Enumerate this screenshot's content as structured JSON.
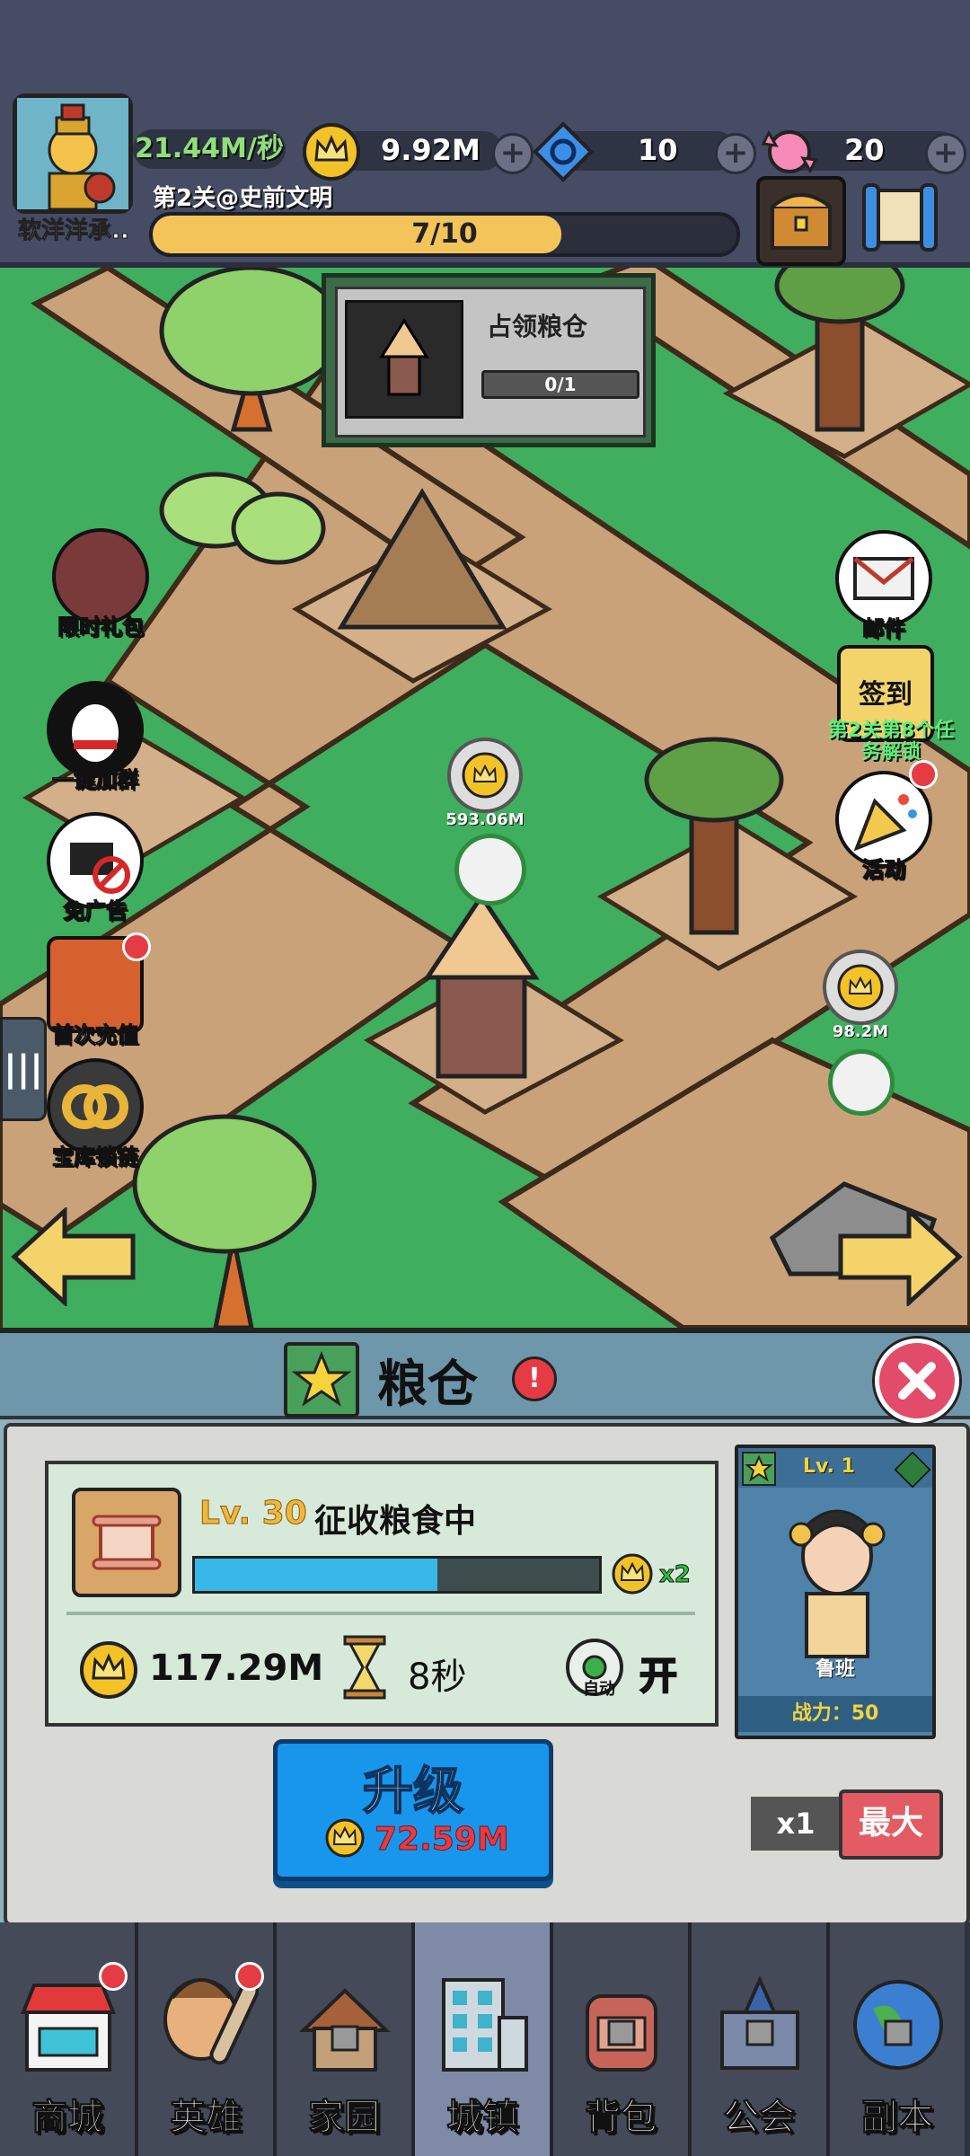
{
  "player": {
    "name": "软洋洋承..",
    "income": "21.44M/秒"
  },
  "resources": {
    "crown": "9.92M",
    "gem": "10",
    "candy": "20"
  },
  "stage": {
    "title": "第2关@史前文明",
    "progress_text": "7/10",
    "progress_fraction": 0.7
  },
  "quest": {
    "title": "占领粮仓",
    "progress": "0/1"
  },
  "left_buttons": [
    {
      "label": "限时礼包"
    },
    {
      "label": "一键加群"
    },
    {
      "label": "免广告"
    },
    {
      "label": "首次充值"
    },
    {
      "label": "宝库锁链"
    }
  ],
  "right_buttons": {
    "mail": "邮件",
    "signin": "签到",
    "signin_sub": "第2关第8个任务解锁",
    "activity": "活动"
  },
  "map_coins": {
    "coin1": "593.06M",
    "coin2": "98.2M"
  },
  "panel": {
    "title": "粮仓",
    "level": "Lv. 30",
    "status": "征收粮食中",
    "multiplier": "x2",
    "collect_fill": 0.6,
    "amount": "117.29M",
    "timer": "8秒",
    "auto_label": "自动",
    "auto_state": "开",
    "upgrade_label": "升级",
    "upgrade_cost": "72.59M",
    "x1_label": "x1",
    "max_label": "最大"
  },
  "hero": {
    "level": "Lv. 1",
    "name": "鲁班",
    "power": "战力：50"
  },
  "nav": [
    {
      "label": "商城"
    },
    {
      "label": "英雄"
    },
    {
      "label": "家园"
    },
    {
      "label": "城镇"
    },
    {
      "label": "背包"
    },
    {
      "label": "公会"
    },
    {
      "label": "副本"
    }
  ],
  "colors": {
    "accent_gold": "#f3c45a",
    "upgrade_blue": "#1796ec",
    "cost_red": "#e53b44",
    "grass": "#3fae5e"
  }
}
